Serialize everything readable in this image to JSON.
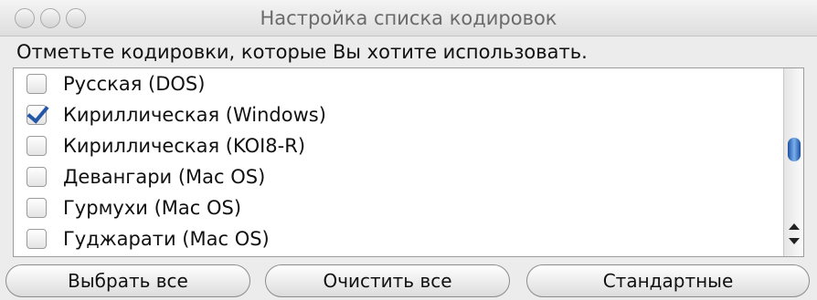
{
  "window": {
    "title": "Настройка списка кодировок"
  },
  "prompt": "Отметьте кодировки, которые Вы хотите использовать.",
  "encodings": [
    {
      "label": "Русская (DOS)",
      "checked": false
    },
    {
      "label": "Кириллическая (Windows)",
      "checked": true
    },
    {
      "label": "Кириллическая (KOI8-R)",
      "checked": false
    },
    {
      "label": "Девангари (Mac OS)",
      "checked": false
    },
    {
      "label": "Гурмухи (Mac OS)",
      "checked": false
    },
    {
      "label": "Гуджарати (Mac OS)",
      "checked": false
    }
  ],
  "buttons": {
    "select_all": "Выбрать все",
    "clear_all": "Очистить все",
    "defaults": "Стандартные"
  },
  "colors": {
    "accent": "#2456a8",
    "scroll_thumb": "#1e4fa0"
  }
}
